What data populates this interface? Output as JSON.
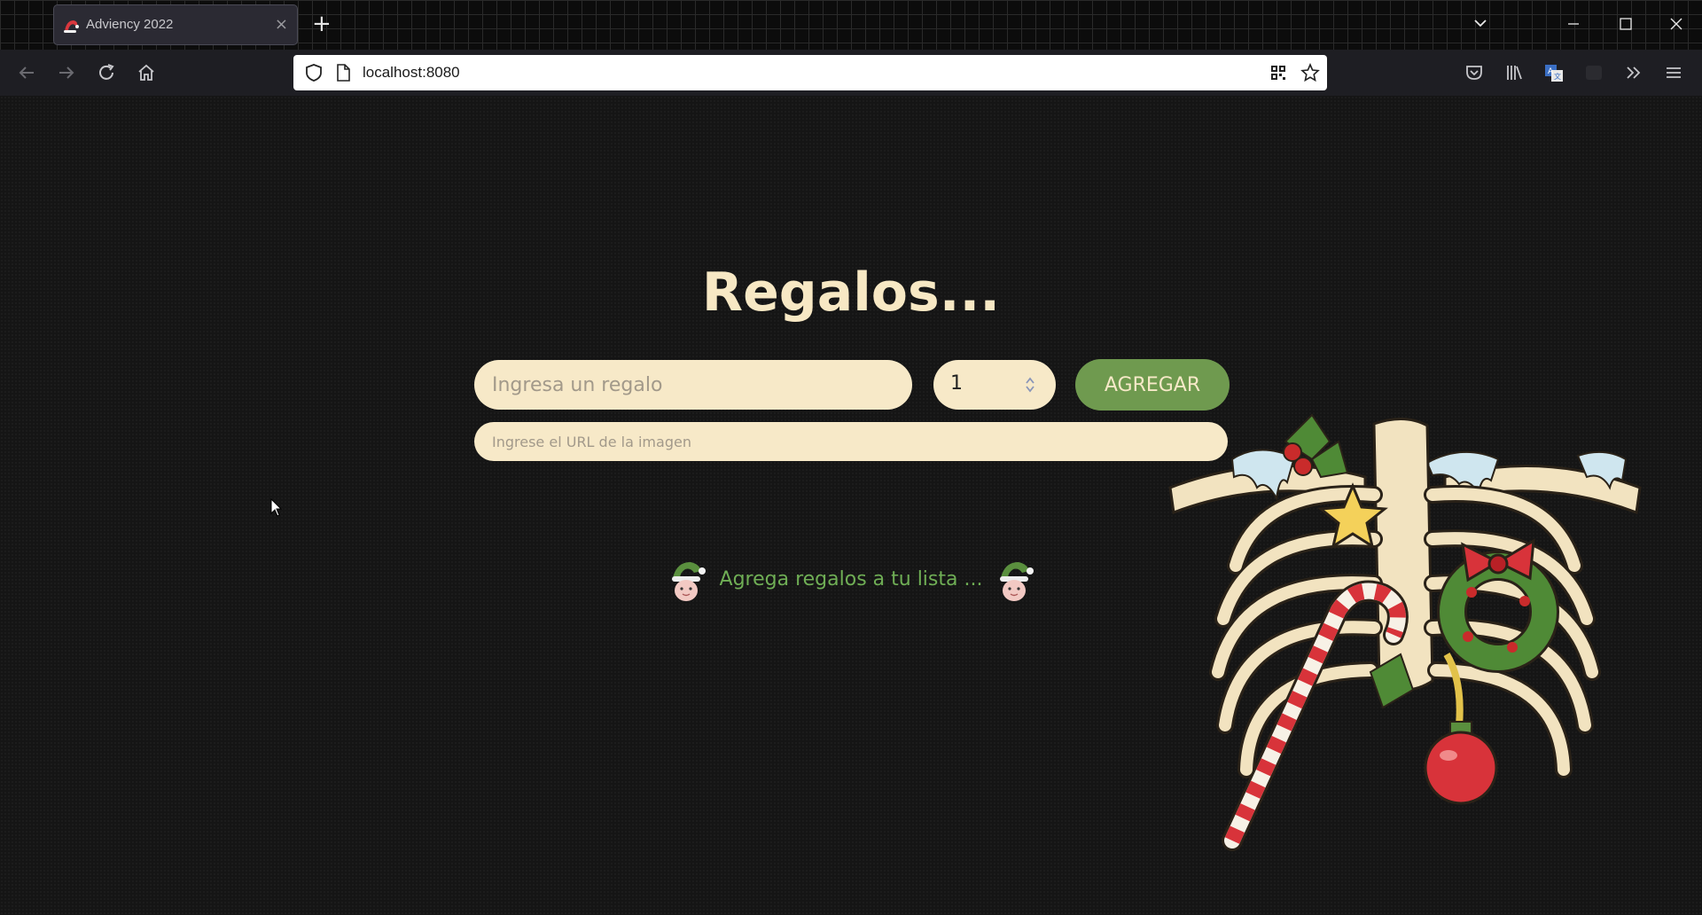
{
  "browser": {
    "tab_title": "Adviency 2022",
    "tab_close": "×",
    "new_tab": "+",
    "url": "localhost:8080",
    "window_controls": {
      "dropdown": "⌄",
      "minimize": "—",
      "maximize": "☐",
      "close": "✕"
    }
  },
  "page": {
    "title": "Regalos...",
    "gift_placeholder": "Ingresa un regalo",
    "quantity": "1",
    "add_button": "AGREGAR",
    "image_url_placeholder": "Ingrese el URL de la imagen",
    "empty_message": "Agrega regalos a tu lista ..."
  },
  "colors": {
    "accent_green": "#6f9a4f",
    "cream": "#f7e9c8",
    "title_cream": "#f7e8c4",
    "message_green": "#6fae55",
    "background": "#151515"
  },
  "icons": [
    "santa-hat-favicon-icon",
    "back-arrow-icon",
    "forward-arrow-icon",
    "reload-icon",
    "home-icon",
    "shield-icon",
    "page-icon",
    "qr-code-icon",
    "star-bookmark-icon",
    "pocket-icon",
    "library-icon",
    "translate-icon",
    "extensions-icon",
    "overflow-chevrons-icon",
    "hamburger-menu-icon",
    "elf-icon",
    "christmas-skeleton-illustration"
  ]
}
